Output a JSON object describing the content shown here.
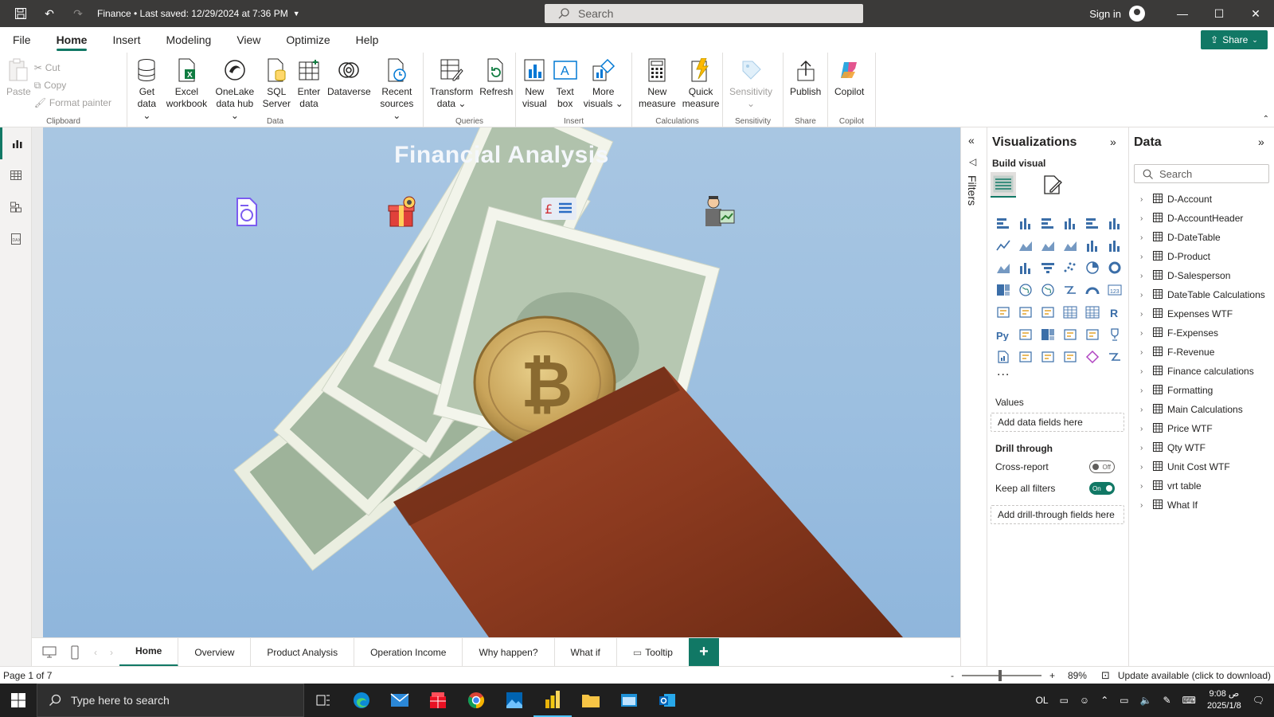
{
  "titlebar": {
    "file_title": "Finance • Last saved: 12/29/2024 at 7:36 PM",
    "search_placeholder": "Search",
    "sign_in": "Sign in"
  },
  "ribbon_tabs": [
    "File",
    "Home",
    "Insert",
    "Modeling",
    "View",
    "Optimize",
    "Help"
  ],
  "share_label": "Share",
  "ribbon": {
    "clipboard": {
      "paste": "Paste",
      "cut": "Cut",
      "copy": "Copy",
      "format_painter": "Format painter",
      "label": "Clipboard"
    },
    "data": {
      "label": "Data",
      "buttons": [
        {
          "l1": "Get",
          "l2": "data ⌄"
        },
        {
          "l1": "Excel",
          "l2": "workbook"
        },
        {
          "l1": "OneLake",
          "l2": "data hub ⌄"
        },
        {
          "l1": "SQL",
          "l2": "Server"
        },
        {
          "l1": "Enter",
          "l2": "data"
        },
        {
          "l1": "Dataverse",
          "l2": ""
        },
        {
          "l1": "Recent",
          "l2": "sources ⌄"
        }
      ]
    },
    "queries": {
      "label": "Queries",
      "transform_1": "Transform",
      "transform_2": "data ⌄",
      "refresh": "Refresh"
    },
    "insert": {
      "label": "Insert",
      "new_visual_1": "New",
      "new_visual_2": "visual",
      "text_box_1": "Text",
      "text_box_2": "box",
      "more_visuals_1": "More",
      "more_visuals_2": "visuals ⌄"
    },
    "calculations": {
      "label": "Calculations",
      "new_measure_1": "New",
      "new_measure_2": "measure",
      "quick_measure_1": "Quick",
      "quick_measure_2": "measure"
    },
    "sensitivity": {
      "label": "Sensitivity",
      "button": "Sensitivity",
      "caret": "⌄"
    },
    "share": {
      "label": "Share",
      "publish": "Publish"
    },
    "copilot": {
      "label": "Copilot",
      "button": "Copilot"
    }
  },
  "report": {
    "title": "Financial Analysis"
  },
  "page_tabs": [
    "Home",
    "Overview",
    "Product Analysis",
    "Operation Income",
    "Why happen?",
    "What if",
    "Tooltip"
  ],
  "status": {
    "page": "Page 1 of 7",
    "zoom": "89%",
    "zoom_fraction": 0.46,
    "update": "Update available (click to download)"
  },
  "filters_label": "Filters",
  "visualizations": {
    "title": "Visualizations",
    "build_visual": "Build visual",
    "more": "...",
    "values_label": "Values",
    "values_well": "Add data fields here",
    "drill_label": "Drill through",
    "cross_report": "Cross-report",
    "cross_report_state": "Off",
    "keep_filters": "Keep all filters",
    "keep_filters_state": "On",
    "drill_well": "Add drill-through fields here"
  },
  "data_pane": {
    "title": "Data",
    "search_placeholder": "Search",
    "tables": [
      "D-Account",
      "D-AccountHeader",
      "D-DateTable",
      "D-Product",
      "D-Salesperson",
      "DateTable Calculations",
      "Expenses WTF",
      "F-Expenses",
      "F-Revenue",
      "Finance calculations",
      "Formatting",
      "Main Calculations",
      "Price WTF",
      "Qty WTF",
      "Unit Cost WTF",
      "vrt table",
      "What If"
    ]
  },
  "taskbar": {
    "search_placeholder": "Type here to search",
    "lang": "OL",
    "time": "9:08 ص",
    "date": "2025/1/8"
  },
  "colors": {
    "accent": "#117865",
    "titlebar": "#3b3a39",
    "canvas_bg": "#9cbfe0"
  }
}
